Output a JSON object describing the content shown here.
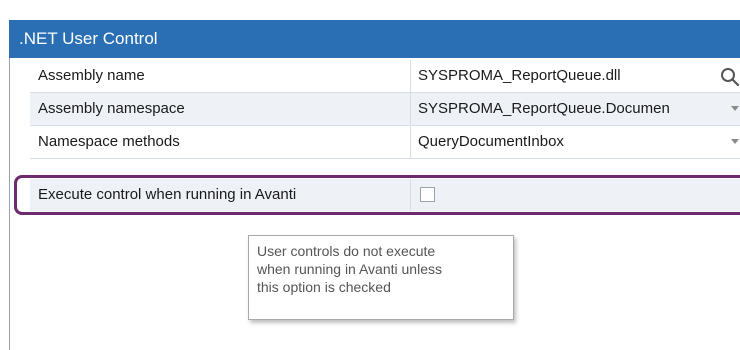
{
  "panel": {
    "title": ".NET User Control"
  },
  "properties": [
    {
      "label": "Assembly name",
      "value": "SYSPROMA_ReportQueue.dll",
      "control": "search-icon"
    },
    {
      "label": "Assembly namespace",
      "value": "SYSPROMA_ReportQueue.Documen",
      "control": "chevron-down-icon"
    },
    {
      "label": "Namespace methods",
      "value": "QueryDocumentInbox",
      "control": "chevron-down-icon"
    },
    {
      "label": "Execute control when running in Avanti",
      "value": "",
      "control": "checkbox",
      "checked": false
    }
  ],
  "tooltip": {
    "lines": [
      "User controls do not execute",
      "when running in Avanti unless",
      "this option is checked"
    ]
  },
  "colors": {
    "header": "#2a6fb4",
    "highlight": "#6d2a6f",
    "row_alt": "#eef2f7"
  }
}
